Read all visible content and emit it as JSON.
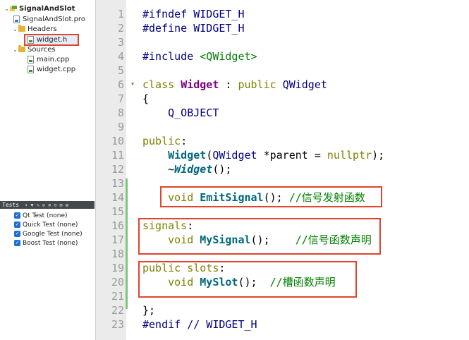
{
  "project_tree": {
    "root": {
      "label": "SignalAndSlot"
    },
    "pro_file": {
      "label": "SignalAndSlot.pro"
    },
    "headers": {
      "label": "Headers",
      "children": [
        "widget.h"
      ]
    },
    "sources": {
      "label": "Sources",
      "children": [
        "main.cpp",
        "widget.cpp"
      ]
    },
    "selected": "widget.h"
  },
  "tests_panel": {
    "title": "Tests",
    "items": [
      "Qt Test (none)",
      "Quick Test (none)",
      "Google Test (none)",
      "Boost Test (none)"
    ]
  },
  "editor": {
    "lines": [
      {
        "n": "1",
        "tokens": [
          {
            "t": "#ifndef WIDGET_H",
            "c": "macro"
          }
        ]
      },
      {
        "n": "2",
        "tokens": [
          {
            "t": "#define WIDGET_H",
            "c": "macro"
          }
        ]
      },
      {
        "n": "3",
        "tokens": []
      },
      {
        "n": "4",
        "tokens": [
          {
            "t": "#include ",
            "c": "macro"
          },
          {
            "t": "<QWidget>",
            "c": "str"
          }
        ]
      },
      {
        "n": "5",
        "tokens": []
      },
      {
        "n": "6",
        "fold": "▾",
        "tokens": [
          {
            "t": "class ",
            "c": "k"
          },
          {
            "t": "Widget",
            "c": "cls"
          },
          {
            "t": " : ",
            "c": ""
          },
          {
            "t": "public ",
            "c": "k"
          },
          {
            "t": "QWidget",
            "c": "cls-plain"
          }
        ]
      },
      {
        "n": "7",
        "tokens": [
          {
            "t": "{",
            "c": ""
          }
        ]
      },
      {
        "n": "8",
        "tokens": [
          {
            "t": "    Q_OBJECT",
            "c": "macro"
          }
        ]
      },
      {
        "n": "9",
        "tokens": []
      },
      {
        "n": "10",
        "tokens": [
          {
            "t": "public",
            "c": "k"
          },
          {
            "t": ":",
            "c": ""
          }
        ]
      },
      {
        "n": "11",
        "tokens": [
          {
            "t": "    ",
            "c": ""
          },
          {
            "t": "Widget",
            "c": "fn"
          },
          {
            "t": "(",
            "c": ""
          },
          {
            "t": "QWidget",
            "c": "cls-plain"
          },
          {
            "t": " *parent = ",
            "c": ""
          },
          {
            "t": "nullptr",
            "c": "k"
          },
          {
            "t": ");",
            "c": ""
          }
        ]
      },
      {
        "n": "12",
        "tokens": [
          {
            "t": "    ~",
            "c": ""
          },
          {
            "t": "Widget",
            "c": "dtor"
          },
          {
            "t": "();",
            "c": ""
          }
        ]
      },
      {
        "n": "13",
        "tokens": []
      },
      {
        "n": "14",
        "tokens": [
          {
            "t": "    ",
            "c": ""
          },
          {
            "t": "void ",
            "c": "k"
          },
          {
            "t": "EmitSignal",
            "c": "fn"
          },
          {
            "t": "(); ",
            "c": ""
          },
          {
            "t": "//信号发射函数",
            "c": "cmt"
          }
        ]
      },
      {
        "n": "15",
        "tokens": []
      },
      {
        "n": "16",
        "tokens": [
          {
            "t": "signals",
            "c": "k"
          },
          {
            "t": ":",
            "c": ""
          }
        ]
      },
      {
        "n": "17",
        "tokens": [
          {
            "t": "    ",
            "c": ""
          },
          {
            "t": "void ",
            "c": "k"
          },
          {
            "t": "MySignal",
            "c": "fn"
          },
          {
            "t": "();    ",
            "c": ""
          },
          {
            "t": "//信号函数声明",
            "c": "cmt"
          }
        ]
      },
      {
        "n": "18",
        "tokens": []
      },
      {
        "n": "19",
        "tokens": [
          {
            "t": "public ",
            "c": "k"
          },
          {
            "t": "slots",
            "c": "k"
          },
          {
            "t": ":",
            "c": ""
          }
        ]
      },
      {
        "n": "20",
        "tokens": [
          {
            "t": "    ",
            "c": ""
          },
          {
            "t": "void ",
            "c": "k"
          },
          {
            "t": "MySlot",
            "c": "fn"
          },
          {
            "t": "();  ",
            "c": ""
          },
          {
            "t": "//槽函数声明",
            "c": "cmt"
          }
        ]
      },
      {
        "n": "21",
        "tokens": []
      },
      {
        "n": "22",
        "tokens": [
          {
            "t": "};",
            "c": ""
          }
        ]
      },
      {
        "n": "23",
        "tokens": [
          {
            "t": "#endif ",
            "c": "macro"
          },
          {
            "t": "// WIDGET_H",
            "c": "cmt-plain"
          }
        ]
      }
    ]
  }
}
